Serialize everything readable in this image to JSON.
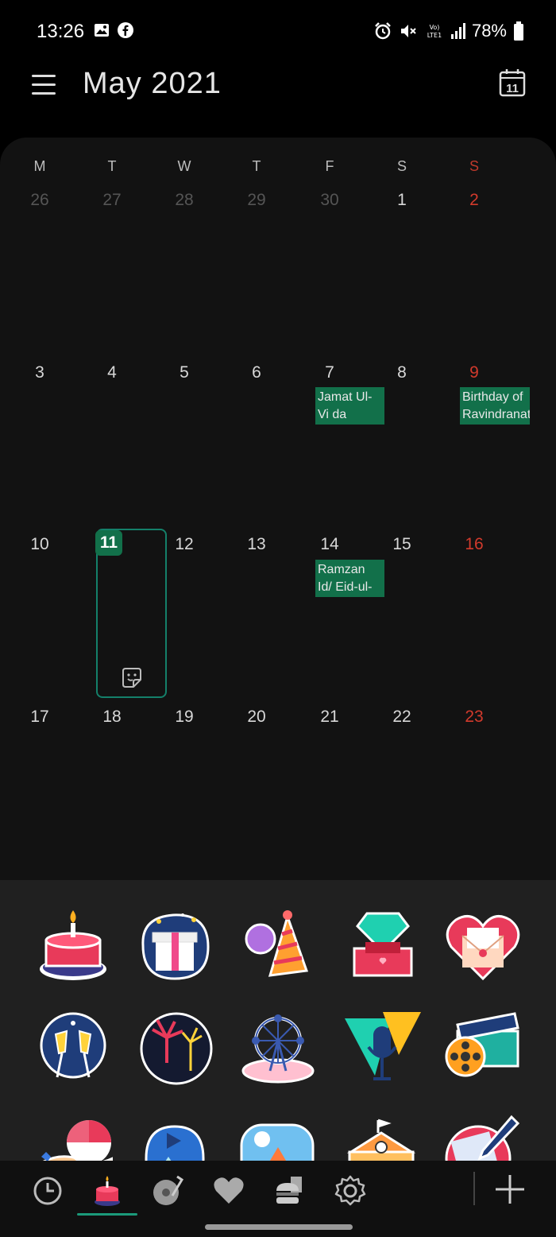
{
  "status_bar": {
    "time": "13:26",
    "battery": "78%"
  },
  "header": {
    "title": "May 2021",
    "today_badge": "11"
  },
  "weekdays": [
    "M",
    "T",
    "W",
    "T",
    "F",
    "S",
    "S"
  ],
  "weeks": [
    [
      "26",
      "27",
      "28",
      "29",
      "30",
      "1",
      "2"
    ],
    [
      "3",
      "4",
      "5",
      "6",
      "7",
      "8",
      "9"
    ],
    [
      "10",
      "11",
      "12",
      "13",
      "14",
      "15",
      "16"
    ],
    [
      "17",
      "18",
      "19",
      "20",
      "21",
      "22",
      "23"
    ]
  ],
  "events": {
    "jamat": "Jamat Ul-Vi da",
    "birthday": "Birthday of Ravindranat",
    "ramzan": "Ramzan Id/ Eid-ul-Fitar"
  },
  "selected_day": "11",
  "colors": {
    "accent": "#12704a",
    "sunday": "#d23a2c",
    "background": "#121212"
  },
  "stickers": [
    "cake-sticker",
    "gift-sticker",
    "party-hat-sticker",
    "ring-box-sticker",
    "love-letter-sticker",
    "cheers-sticker",
    "fireworks-sticker",
    "ferris-wheel-sticker",
    "microphone-sticker",
    "film-reel-sticker",
    "beach-umbrella-sticker",
    "mountain-play-sticker",
    "camping-sticker",
    "school-sticker",
    "pencil-sticker"
  ],
  "bottom_tabs": [
    "recent-icon",
    "cake-icon",
    "music-icon",
    "heart-icon",
    "food-icon",
    "settings-icon",
    "add-icon"
  ]
}
